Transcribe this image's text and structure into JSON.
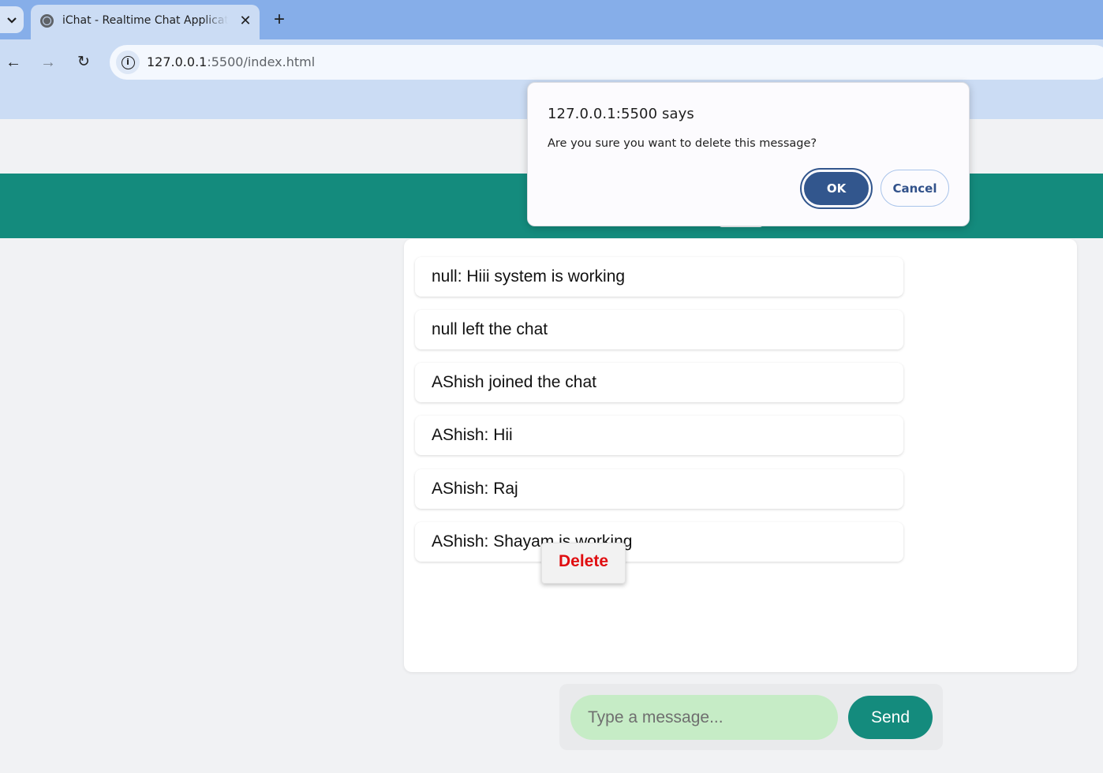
{
  "browser": {
    "tab_list_icon": "chevron-down-icon",
    "tab": {
      "title": "iChat - Realtime Chat Application",
      "favicon": "globe-icon"
    },
    "tab_close_glyph": "✕",
    "new_tab_glyph": "+",
    "nav": {
      "back_glyph": "←",
      "forward_glyph": "→",
      "reload_glyph": "↻"
    },
    "address": {
      "host": "127.0.0.1",
      "path": ":5500/index.html",
      "info_glyph": "i"
    }
  },
  "chat": {
    "messages": [
      "null: Hiii system is working",
      "null left the chat",
      "AShish joined the chat",
      "AShish: Hii",
      "AShish: Raj",
      "AShish: Shayam is working"
    ],
    "context_menu": {
      "delete_label": "Delete"
    },
    "composer": {
      "placeholder": "Type a message...",
      "send_label": "Send"
    }
  },
  "dialog": {
    "title": "127.0.0.1:5500 says",
    "message": "Are you sure you want to delete this message?",
    "ok_label": "OK",
    "cancel_label": "Cancel"
  },
  "colors": {
    "header": "#148b7d",
    "send_button": "#148b7d",
    "input_bg": "#c6ecc6",
    "delete_text": "#e00d10",
    "dialog_ok": "#32568d"
  }
}
